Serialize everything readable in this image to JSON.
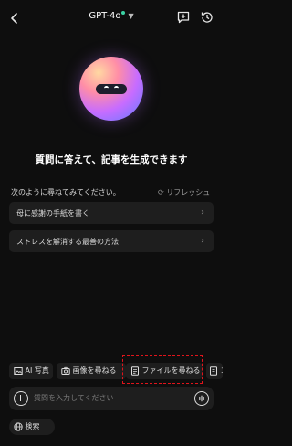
{
  "header": {
    "title": "GPT-4o"
  },
  "hero": {
    "headline": "質問に答えて、記事を生成できます"
  },
  "suggestions": {
    "label": "次のように尋ねてみてください。",
    "refresh_label": "リフレッシュ",
    "items": [
      {
        "label": "母に感謝の手紙を書く"
      },
      {
        "label": "ストレスを解消する最善の方法"
      }
    ]
  },
  "chips": [
    {
      "label": "AI 写真",
      "icon": "image-icon"
    },
    {
      "label": "画像を尋ねる",
      "icon": "camera-icon"
    },
    {
      "label": "ファイルを尋ねる",
      "icon": "file-icon"
    },
    {
      "label": "コ",
      "icon": "document-icon"
    }
  ],
  "input": {
    "placeholder": "質問を入力してください"
  },
  "search": {
    "label": "検索"
  },
  "colors": {
    "background": "#0e0e0e",
    "surface": "#1e1e1e",
    "highlight": "#e0141b",
    "online": "#3bd3a4"
  }
}
